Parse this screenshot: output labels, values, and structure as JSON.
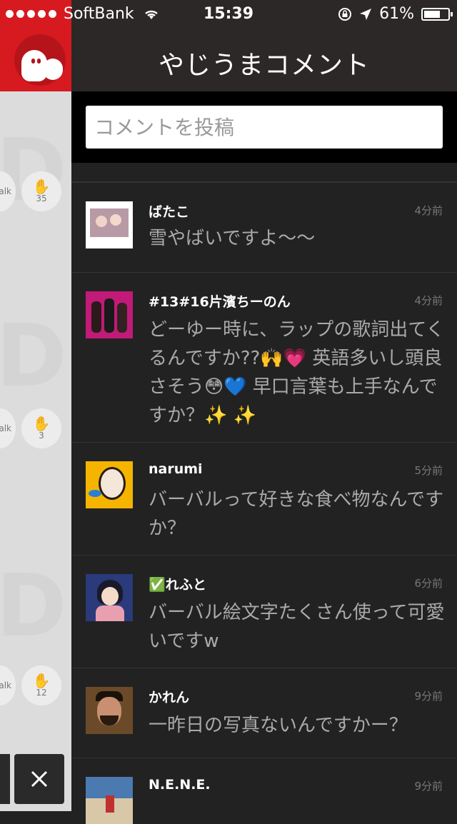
{
  "status_bar": {
    "carrier": "SoftBank",
    "time": "15:39",
    "battery": "61%"
  },
  "sidebar": {
    "buttons": [
      {
        "talk_label": "alk",
        "count": "35"
      },
      {
        "talk_label": "alk",
        "count": "3"
      },
      {
        "talk_label": "alk",
        "count": "12"
      }
    ]
  },
  "header": {
    "title": "やじうまコメント"
  },
  "search": {
    "placeholder": "コメントを投稿"
  },
  "comments": [
    {
      "name": "ばたこ",
      "time": "4分前",
      "text": "雪やばいですよ〜〜"
    },
    {
      "name": "#13#16片濱ちーのん",
      "time": "4分前",
      "text": "どーゆー時に、ラップの歌詞出てくるんですか??🙌💗 英語多いし頭良さそう😳💙 早口言葉も上手なんですか？✨ ✨"
    },
    {
      "name": "narumi",
      "time": "5分前",
      "text": "バーバルって好きな食べ物なんですか？"
    },
    {
      "name": "✅れふと",
      "time": "6分前",
      "text": "バーバル絵文字たくさん使って可愛いですw"
    },
    {
      "name": "かれん",
      "time": "9分前",
      "text": "一昨日の写真ないんですかー？"
    },
    {
      "name": "N.E.N.E.",
      "time": "9分前",
      "text": ""
    }
  ]
}
